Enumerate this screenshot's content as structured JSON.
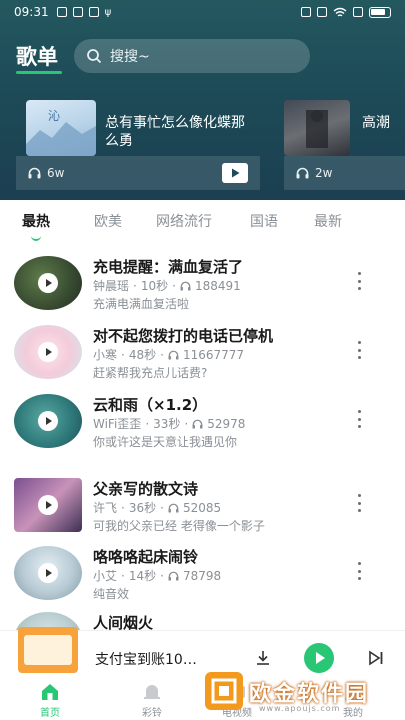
{
  "status_bar": {
    "time": "09:31"
  },
  "header": {
    "title": "歌单",
    "search_placeholder": "搜搜~"
  },
  "featured": [
    {
      "title": "总有事忙怎么像化蝶那么勇",
      "play_count": "6w"
    },
    {
      "title": "高潮",
      "play_count": "2w"
    }
  ],
  "tabs": [
    "最热",
    "欧美",
    "网络流行",
    "国语",
    "最新"
  ],
  "active_tab": 0,
  "songs": [
    {
      "title": "充电提醒：满血复活了",
      "artist": "钟晨瑶",
      "duration": "10秒",
      "plays": "188491",
      "desc": "充满电满血复活啦"
    },
    {
      "title": "对不起您拨打的电话已停机",
      "artist": "小寒",
      "duration": "48秒",
      "plays": "11667777",
      "desc": "赶紧帮我充点儿话费?"
    },
    {
      "title": "云和雨（×1.2）",
      "artist": "WiFi歪歪",
      "duration": "33秒",
      "plays": "52978",
      "desc": "你或许这是天意让我遇见你"
    },
    {
      "title": "父亲写的散文诗",
      "artist": "许飞",
      "duration": "36秒",
      "plays": "52085",
      "desc": "可我的父亲已经 老得像一个影子"
    },
    {
      "title": "咯咯咯起床闹铃",
      "artist": "小艾",
      "duration": "14秒",
      "plays": "78798",
      "desc": "纯音效"
    },
    {
      "title": "人间烟火",
      "artist": "",
      "duration": "",
      "plays": "",
      "desc": ""
    }
  ],
  "player": {
    "now_playing": "支付宝到账10…"
  },
  "nav": [
    {
      "label": "首页",
      "icon": "home-icon",
      "active": true
    },
    {
      "label": "彩铃",
      "icon": "bell-icon",
      "active": false
    },
    {
      "label": "电视频",
      "icon": "tv-icon",
      "active": false
    },
    {
      "label": "我的",
      "icon": "user-icon",
      "active": false
    }
  ],
  "watermark": {
    "brand": "欧金软件园",
    "url": "www.apoujs.com"
  },
  "colors": {
    "accent": "#29c675",
    "header_bg": "#1d4b57",
    "watermark": "#f39a1e"
  }
}
